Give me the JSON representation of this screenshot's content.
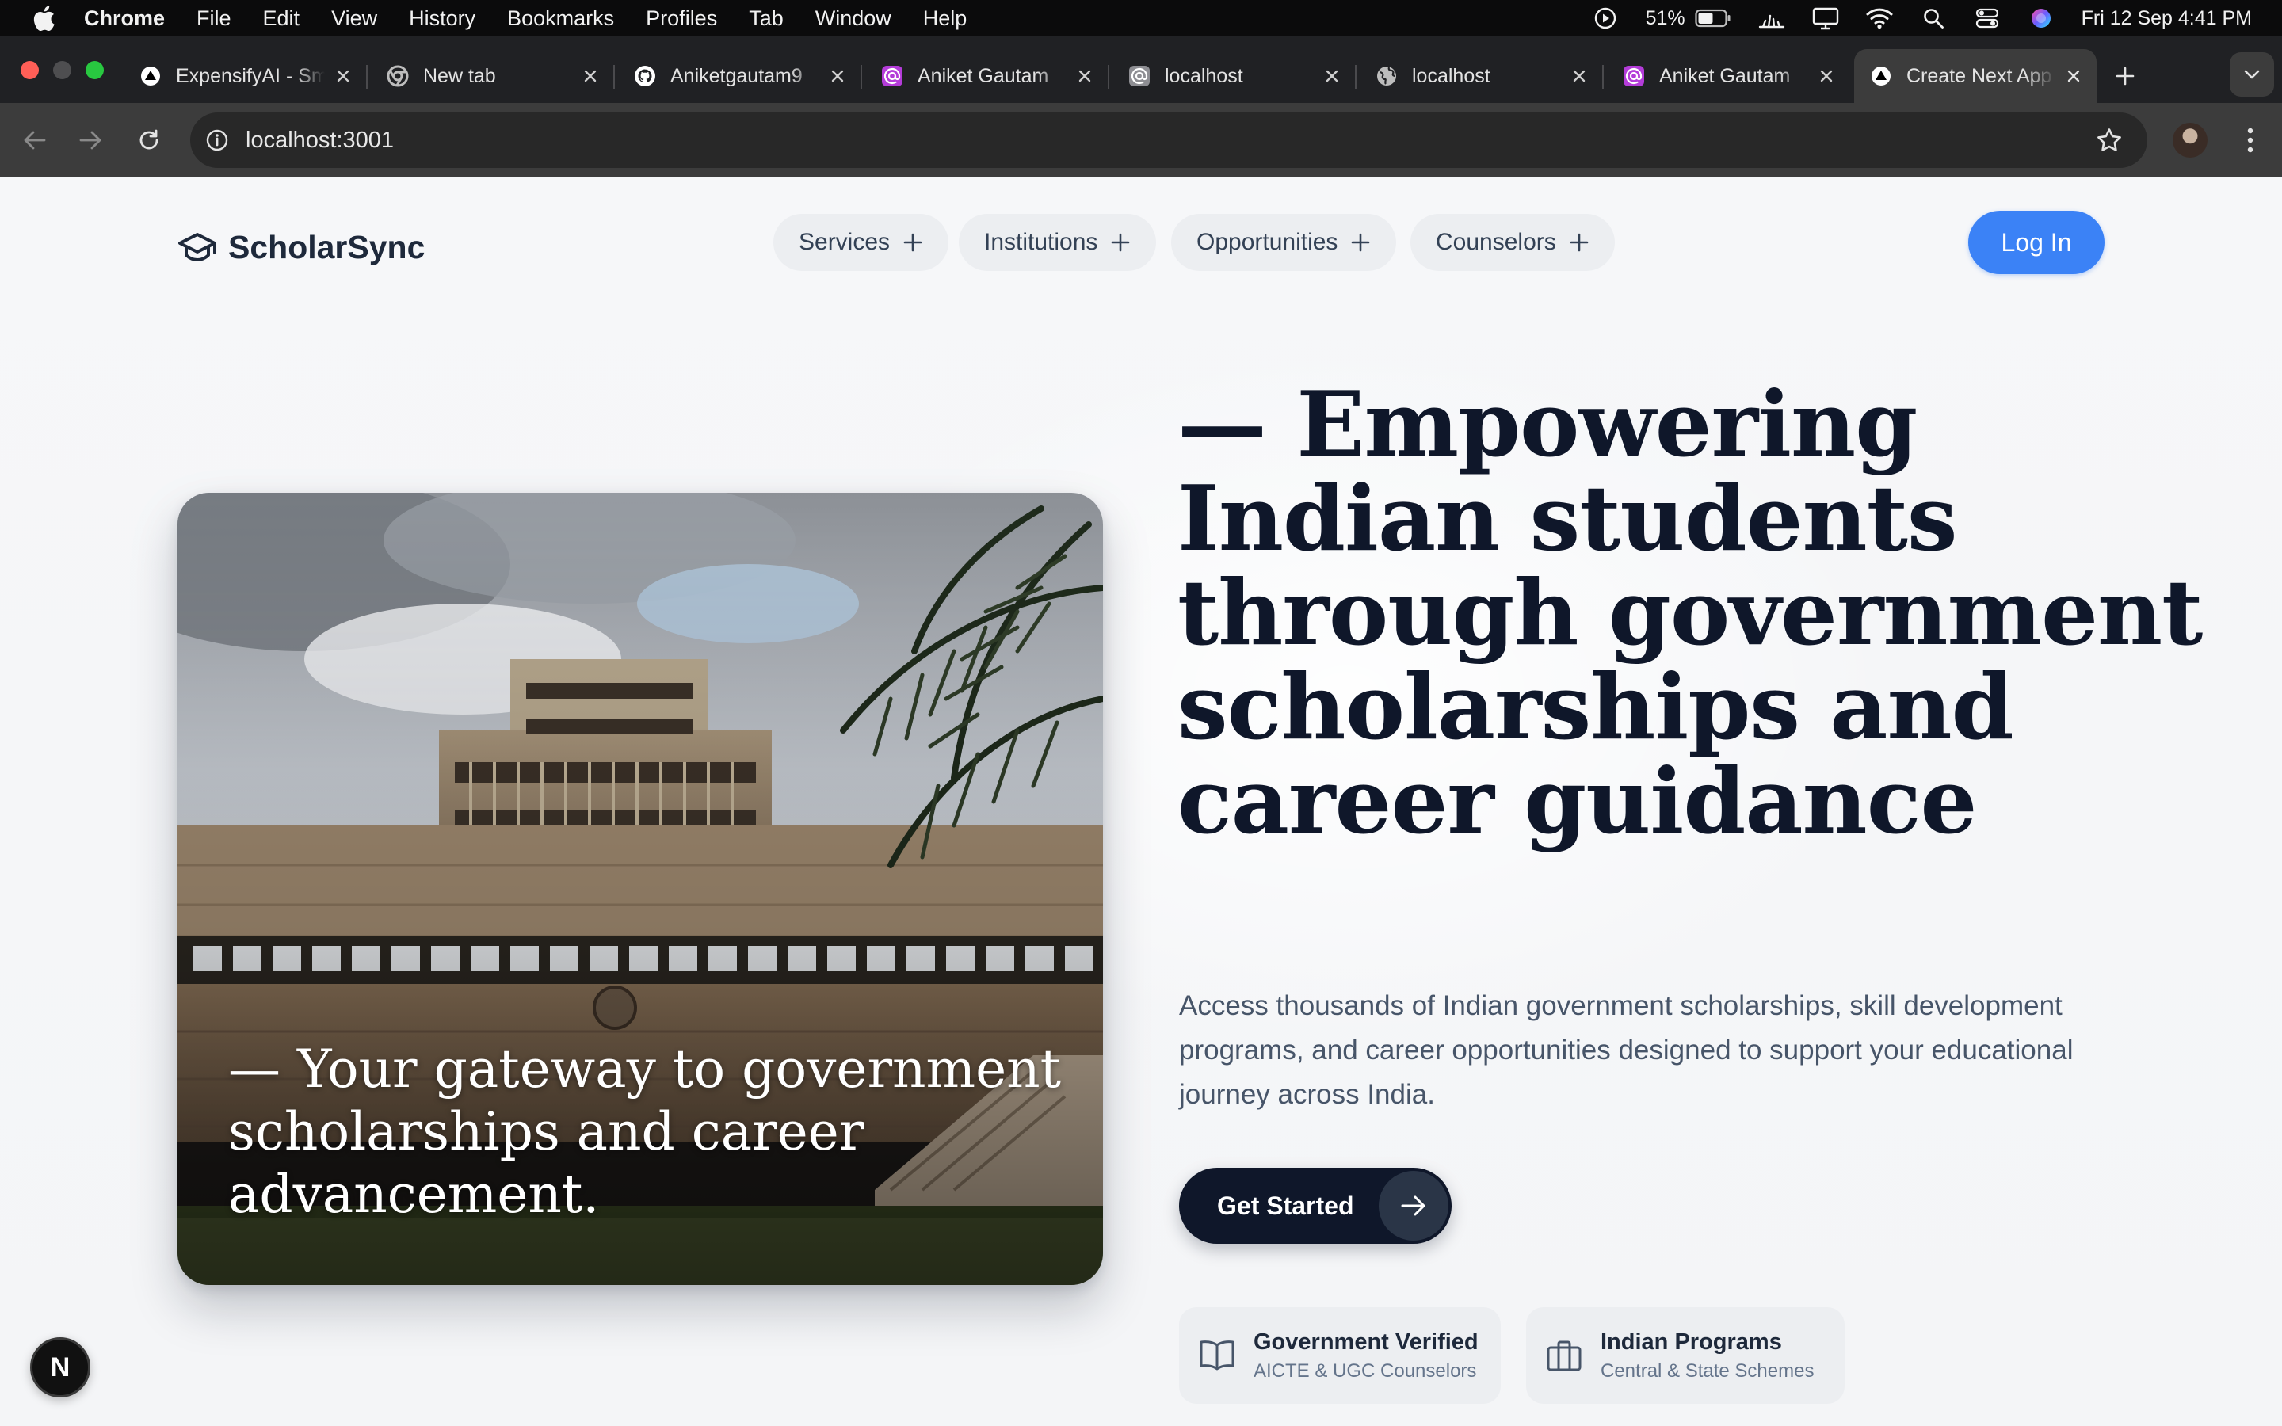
{
  "menubar": {
    "app": "Chrome",
    "items": [
      "File",
      "Edit",
      "View",
      "History",
      "Bookmarks",
      "Profiles",
      "Tab",
      "Window",
      "Help"
    ],
    "battery": "51%",
    "datetime": "Fri 12 Sep  4:41 PM"
  },
  "tabs": [
    {
      "title": "ExpensifyAI - Smart",
      "icon": "triangle-icon"
    },
    {
      "title": "New tab",
      "icon": "chrome-icon"
    },
    {
      "title": "Aniketgautam9",
      "icon": "github-icon"
    },
    {
      "title": "Aniket Gautam",
      "icon": "at-sign-icon"
    },
    {
      "title": "localhost",
      "icon": "at-sign-icon"
    },
    {
      "title": "localhost",
      "icon": "globe-icon"
    },
    {
      "title": "Aniket Gautam",
      "icon": "at-sign-icon"
    },
    {
      "title": "Create Next App",
      "icon": "triangle-icon"
    }
  ],
  "toolbar": {
    "url": "localhost:3001"
  },
  "site": {
    "brand": "ScholarSync",
    "nav": [
      "Services",
      "Institutions",
      "Opportunities",
      "Counselors"
    ],
    "login": "Log In",
    "image_caption": "— Your gateway to government scholarships and career advancement.",
    "headline": "— Empowering Indian students through government scholarships and career guidance",
    "subtext": "Access thousands of Indian government scholarships, skill development programs, and career opportunities designed to support your educational journey across India.",
    "cta": "Get Started",
    "features": [
      {
        "title": "Government Verified",
        "subtitle": "AICTE & UGC Counselors",
        "icon": "book-icon"
      },
      {
        "title": "Indian Programs",
        "subtitle": "Central & State Schemes",
        "icon": "briefcase-icon"
      }
    ]
  },
  "dev_indicator": "N",
  "colors": {
    "accent": "#3b82f6",
    "dark": "#0f172a",
    "chrome_bg": "#202124",
    "toolbar_bg": "#3c3c3c"
  }
}
